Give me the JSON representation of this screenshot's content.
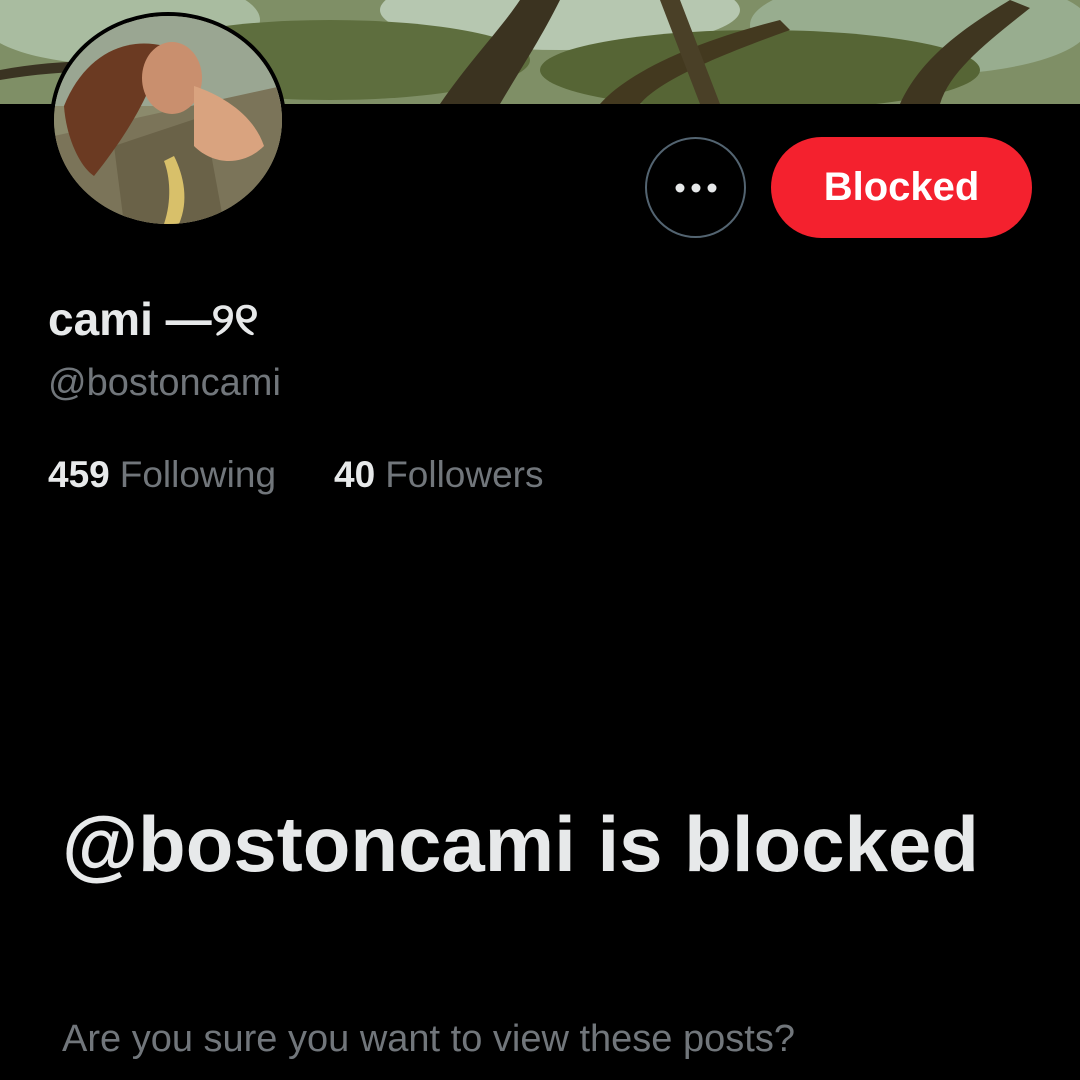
{
  "profile": {
    "display_name": "cami —୨୧",
    "handle": "@bostoncami",
    "stats": [
      {
        "count": "459",
        "label": "Following"
      },
      {
        "count": "40",
        "label": "Followers"
      }
    ]
  },
  "actions": {
    "more_icon": "more-horizontal-icon",
    "blocked_label": "Blocked",
    "blocked_color": "#f4212e"
  },
  "blocked_notice": {
    "title": "@bostoncami is blocked",
    "subtitle": "Are you sure you want to view these posts?"
  },
  "colors": {
    "background": "#000000",
    "primary_text": "#e7e9ea",
    "secondary_text": "#71767b",
    "border": "#536471"
  }
}
